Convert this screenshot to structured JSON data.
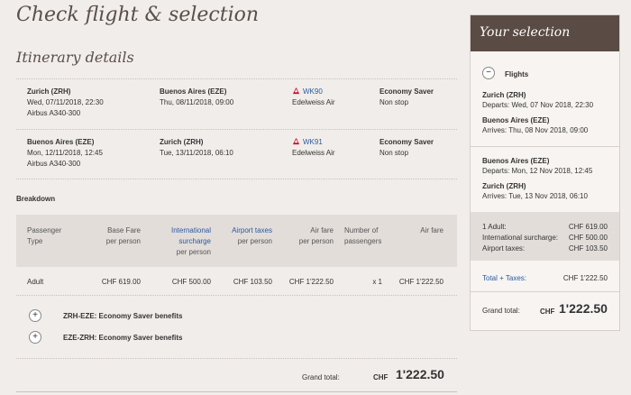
{
  "page": {
    "title": "Check flight & selection",
    "subtitle": "Itinerary details"
  },
  "itinerary": [
    {
      "from": "Zurich (ZRH)",
      "dep_date": "Wed, 07/11/2018, 22:30",
      "aircraft": "Airbus A340-300",
      "to": "Buenos Aires (EZE)",
      "arr_date": "Thu, 08/11/2018, 09:00",
      "flight_no": "WK90",
      "airline": "Edelweiss Air",
      "fare": "Economy Saver",
      "stops": "Non stop"
    },
    {
      "from": "Buenos Aires (EZE)",
      "dep_date": "Mon, 12/11/2018, 12:45",
      "aircraft": "Airbus A340-300",
      "to": "Zurich (ZRH)",
      "arr_date": "Tue, 13/11/2018, 06:10",
      "flight_no": "WK91",
      "airline": "Edelweiss Air",
      "fare": "Economy Saver",
      "stops": "Non stop"
    }
  ],
  "breakdown": {
    "label": "Breakdown",
    "headers": {
      "passenger_1": "Passenger",
      "passenger_2": "Type",
      "base_1": "Base Fare",
      "base_2": "per person",
      "intl_1": "International",
      "intl_2": "surcharge",
      "intl_3": "per person",
      "tax_1": "Airport taxes",
      "tax_2": "per person",
      "air_1": "Air fare",
      "air_2": "per person",
      "num_1": "Number of",
      "num_2": "passengers",
      "total": "Air fare"
    },
    "row": {
      "type": "Adult",
      "base": "CHF 619.00",
      "intl": "CHF 500.00",
      "tax": "CHF 103.50",
      "air": "CHF 1'222.50",
      "count": "x 1",
      "total": "CHF 1'222.50"
    },
    "benefits": [
      "ZRH-EZE: Economy Saver benefits",
      "EZE-ZRH: Economy Saver benefits"
    ],
    "expand_symbol": "+",
    "grand_total_label": "Grand total:",
    "grand_total_currency": "CHF",
    "grand_total_value": "1'222.50"
  },
  "sidebar": {
    "title": "Your selection",
    "collapse_symbol": "−",
    "flights_label": "Flights",
    "segments": [
      {
        "city": "Zurich (ZRH)",
        "line": "Departs: Wed, 07 Nov 2018, 22:30"
      },
      {
        "city": "Buenos Aires (EZE)",
        "line": "Arrives:   Thu, 08 Nov 2018, 09:00"
      },
      {
        "city": "Buenos Aires (EZE)",
        "line": "Departs: Mon, 12 Nov 2018, 12:45"
      },
      {
        "city": "Zurich (ZRH)",
        "line": "Arrives:   Tue, 13 Nov 2018, 06:10"
      }
    ],
    "costs": [
      {
        "label": "1 Adult:",
        "value": "CHF 619.00"
      },
      {
        "label": "International surcharge:",
        "value": "CHF 500.00"
      },
      {
        "label": "Airport taxes:",
        "value": "CHF 103.50"
      }
    ],
    "total_taxes_label": "Total + Taxes:",
    "total_taxes_value": "CHF 1'222.50",
    "grand_total_label": "Grand total:",
    "grand_total_currency": "CHF",
    "grand_total_value": "1'222.50"
  },
  "colors": {
    "accent_link": "#2a5aa0",
    "header_brown": "#5a4c44",
    "flag_red": "#c8102e"
  }
}
